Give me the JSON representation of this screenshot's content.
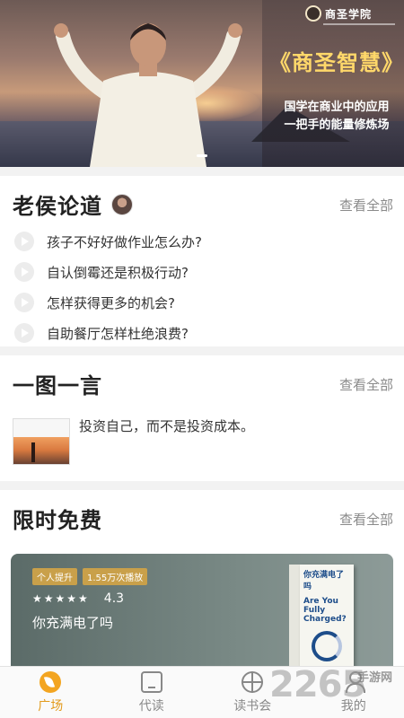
{
  "banner": {
    "logo_text": "商圣学院",
    "headline": "《商圣智慧》",
    "tagline_line1": "国学在商业中的应用",
    "tagline_line2": "一把手的能量修炼场"
  },
  "section_lao_hou": {
    "title": "老侯论道",
    "see_all": "查看全部",
    "topics": [
      "孩子不好好做作业怎么办?",
      "自认倒霉还是积极行动?",
      "怎样获得更多的机会?",
      "自助餐厅怎样杜绝浪费?"
    ]
  },
  "section_picture_quote": {
    "title": "一图一言",
    "see_all": "查看全部",
    "quote": "投资自己，而不是投资成本。"
  },
  "section_free": {
    "title": "限时免费",
    "see_all": "查看全部",
    "tag_1": "个人提升",
    "tag_2": "1.55万次播放",
    "stars": "★★★★★",
    "rating": "4.3",
    "book_title": "你充满电了吗",
    "book_cover_cn": "你充满电了吗",
    "book_cover_en": "Are You Fully Charged?"
  },
  "tabbar": {
    "tabs": [
      {
        "label": "广场",
        "icon": "plaza-icon",
        "active": true
      },
      {
        "label": "代读",
        "icon": "book-icon",
        "active": false
      },
      {
        "label": "读书会",
        "icon": "globe-icon",
        "active": false
      },
      {
        "label": "我的",
        "icon": "person-icon",
        "active": false
      }
    ]
  },
  "watermark": {
    "number": "2265",
    "site": "手游网"
  },
  "colors": {
    "accent": "#e29a1c",
    "tag_gold": "#c9a04a",
    "headline_gold": "#ffd86a"
  }
}
